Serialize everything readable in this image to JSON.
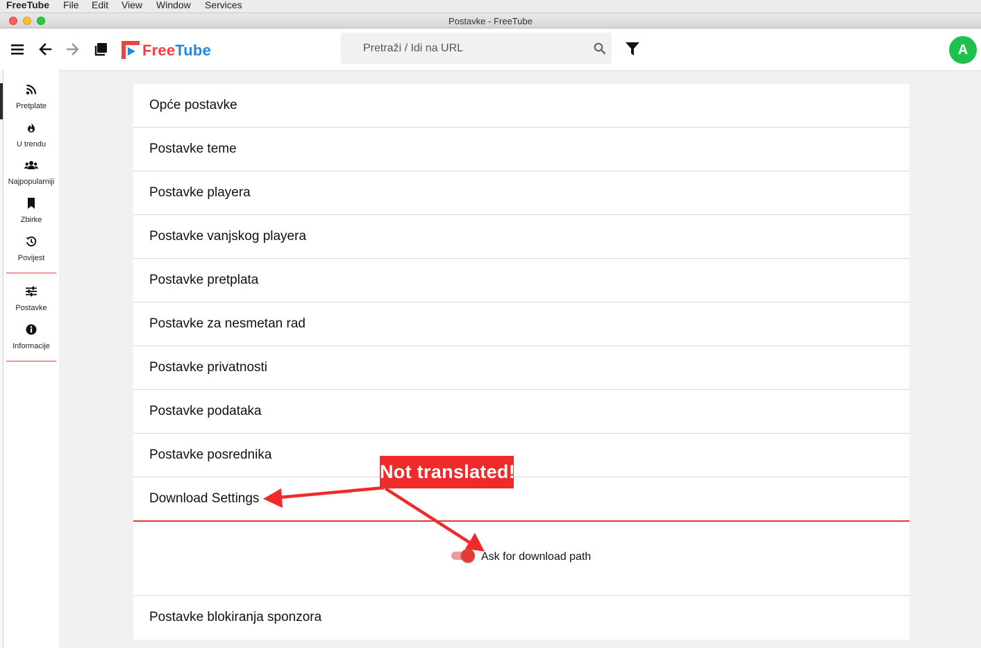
{
  "menubar": {
    "app": "FreeTube",
    "items": [
      "File",
      "Edit",
      "View",
      "Window",
      "Services"
    ]
  },
  "window": {
    "title": "Postavke - FreeTube"
  },
  "topnav": {
    "logo_free": "Free",
    "logo_tube": "Tube",
    "search_placeholder": "Pretraži / Idi na URL",
    "avatar_letter": "A"
  },
  "sidebar": {
    "items": [
      {
        "label": "Pretplate",
        "icon": "rss-icon"
      },
      {
        "label": "U trendu",
        "icon": "fire-icon"
      },
      {
        "label": "Najpopularniji",
        "icon": "users-icon"
      },
      {
        "label": "Zbirke",
        "icon": "bookmark-icon"
      },
      {
        "label": "Povijest",
        "icon": "history-icon"
      },
      {
        "label": "Postavke",
        "icon": "sliders-icon"
      },
      {
        "label": "Informacije",
        "icon": "info-icon"
      }
    ]
  },
  "settings": {
    "sections": [
      "Opće postavke",
      "Postavke teme",
      "Postavke playera",
      "Postavke vanjskog playera",
      "Postavke pretplata",
      "Postavke za nesmetan rad",
      "Postavke privatnosti",
      "Postavke podataka",
      "Postavke posrednika"
    ],
    "download": {
      "title": "Download Settings",
      "toggle_label": "Ask for download path",
      "toggle_on": true
    },
    "last_section": "Postavke blokiranja sponzora"
  },
  "annotation": {
    "text": "Not translated!"
  },
  "colors": {
    "accent": "#e53935",
    "logo_red": "#f04242",
    "logo_blue": "#1e88e5",
    "avatar": "#1ec24b",
    "annotation": "#f02a2a"
  }
}
